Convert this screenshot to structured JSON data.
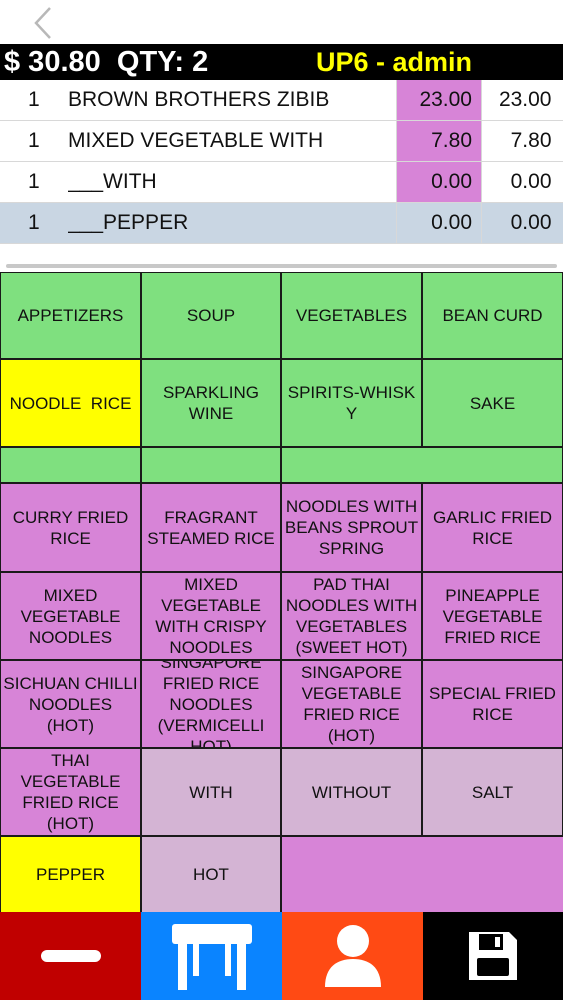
{
  "status": {
    "total": "$ 30.80",
    "qty": "QTY: 2",
    "user": "UP6 - admin"
  },
  "orders": [
    {
      "qty": "1",
      "name": "BROWN BROTHERS ZIBIB",
      "price": "23.00",
      "total": "23.00"
    },
    {
      "qty": "1",
      "name": "MIXED VEGETABLE WITH",
      "price": "7.80",
      "total": "7.80"
    },
    {
      "qty": "1",
      "name": "___WITH",
      "price": "0.00",
      "total": "0.00"
    },
    {
      "qty": "1",
      "name": "___PEPPER",
      "price": "0.00",
      "total": "0.00"
    }
  ],
  "categories": [
    "APPETIZERS",
    "SOUP",
    "VEGETABLES",
    "BEAN CURD",
    "NOODLE  RICE",
    "SPARKLING WINE",
    "SPIRITS-WHISKY",
    "SAKE"
  ],
  "items": [
    "CURRY FRIED RICE",
    "FRAGRANT STEAMED RICE",
    "NOODLES WITH BEANS SPROUT SPRING",
    "GARLIC FRIED RICE",
    "MIXED VEGETABLE NOODLES",
    "MIXED VEGETABLE WITH CRISPY NOODLES",
    "PAD THAI NOODLES WITH VEGETABLES (SWEET HOT)",
    "PINEAPPLE VEGETABLE FRIED RICE",
    "SICHUAN CHILLI NOODLES (HOT)",
    "SINGAPORE FRIED RICE NOODLES (VERMICELLI HOT)",
    "SINGAPORE VEGETABLE FRIED RICE (HOT)",
    "SPECIAL FRIED RICE",
    "THAI VEGETABLE FRIED RICE (HOT)"
  ],
  "modifiers": [
    "WITH",
    "WITHOUT",
    "SALT",
    "PEPPER",
    "HOT"
  ],
  "colors": {
    "category": "#7fe07f",
    "selected_category": "#ffff00",
    "item": "#d784d7",
    "modifier": "#d4b4d4",
    "highlight_modifier": "#ffff00",
    "selected_row": "#c9d6e3",
    "toolbar_remove": "#c00000",
    "toolbar_table": "#0a84ff",
    "toolbar_customer": "#ff4a14",
    "toolbar_save": "#000000"
  },
  "icons": {
    "back": "chevron-left-icon",
    "remove": "minus-icon",
    "table": "table-icon",
    "customer": "person-icon",
    "save": "floppy-disk-icon"
  }
}
